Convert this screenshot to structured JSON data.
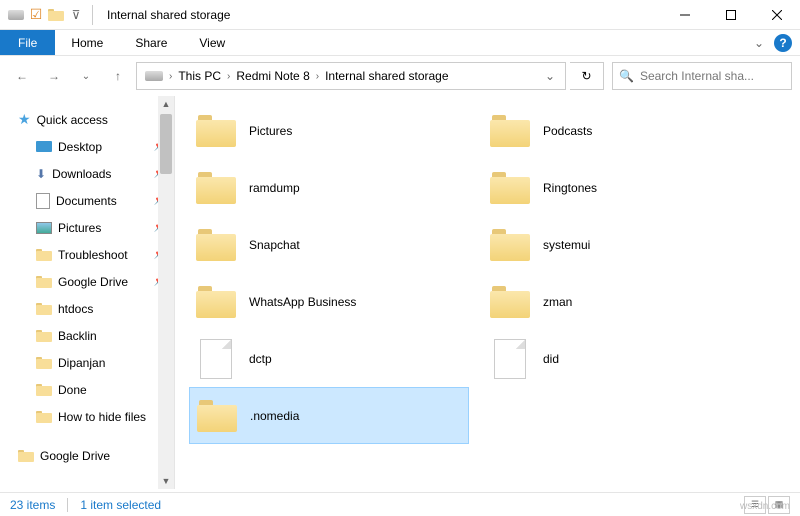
{
  "title": "Internal shared storage",
  "ribbon": {
    "file": "File",
    "tabs": [
      "Home",
      "Share",
      "View"
    ]
  },
  "breadcrumb": [
    "This PC",
    "Redmi Note 8",
    "Internal shared storage"
  ],
  "search_placeholder": "Search Internal sha...",
  "sidebar": {
    "quick_access": "Quick access",
    "items": [
      {
        "label": "Desktop",
        "pinned": true
      },
      {
        "label": "Downloads",
        "pinned": true
      },
      {
        "label": "Documents",
        "pinned": true
      },
      {
        "label": "Pictures",
        "pinned": true
      },
      {
        "label": "Troubleshoot",
        "pinned": true
      },
      {
        "label": "Google Drive",
        "pinned": true
      },
      {
        "label": "htdocs",
        "pinned": false
      },
      {
        "label": "Backlin",
        "pinned": false
      },
      {
        "label": "Dipanjan",
        "pinned": false
      },
      {
        "label": "Done",
        "pinned": false
      },
      {
        "label": "How to hide files",
        "pinned": false
      }
    ],
    "google_drive": "Google Drive"
  },
  "items_col1": [
    {
      "name": "Pictures",
      "type": "folder"
    },
    {
      "name": "ramdump",
      "type": "folder"
    },
    {
      "name": "Snapchat",
      "type": "folder"
    },
    {
      "name": "WhatsApp Business",
      "type": "folder"
    },
    {
      "name": "dctp",
      "type": "file"
    },
    {
      "name": ".nomedia",
      "type": "folder",
      "selected": true
    }
  ],
  "items_col2": [
    {
      "name": "Podcasts",
      "type": "folder"
    },
    {
      "name": "Ringtones",
      "type": "folder"
    },
    {
      "name": "systemui",
      "type": "folder"
    },
    {
      "name": "zman",
      "type": "folder"
    },
    {
      "name": "did",
      "type": "file"
    }
  ],
  "status": {
    "count": "23 items",
    "selected": "1 item selected"
  },
  "watermark": "wsxdn.com"
}
